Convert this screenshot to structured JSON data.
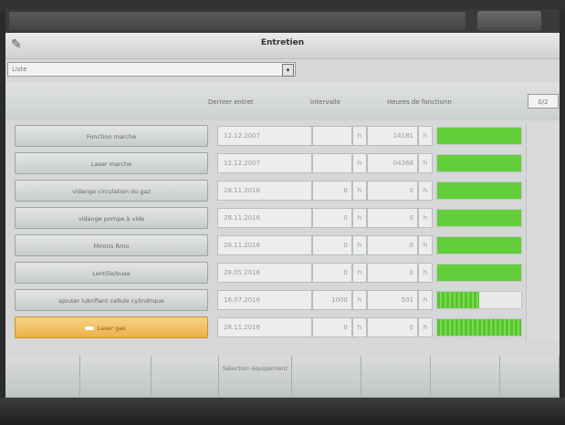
{
  "window": {
    "title": "Entretien"
  },
  "filter": {
    "value": "Liste",
    "arrow": "▾"
  },
  "headers": {
    "last_service": "Dernier entret",
    "interval": "Intervalle",
    "operating_hours": "Heures de fonctionn",
    "right_box": "0/2"
  },
  "rows": [
    {
      "label": "Fonction marche",
      "date": "12.12.2007",
      "interval": "",
      "interval_unit": "h",
      "hours": "14181",
      "hours_unit": "h",
      "level": 1.0,
      "active": false
    },
    {
      "label": "Laser marche",
      "date": "12.12.2007",
      "interval": "",
      "interval_unit": "h",
      "hours": "04368",
      "hours_unit": "h",
      "level": 1.0,
      "active": false
    },
    {
      "label": "vidange circulation du gaz",
      "date": "28.11.2016",
      "interval": "0",
      "interval_unit": "h",
      "hours": "0",
      "hours_unit": "h",
      "level": 1.0,
      "active": false
    },
    {
      "label": "vidange pompe à vide",
      "date": "28.11.2016",
      "interval": "0",
      "interval_unit": "h",
      "hours": "0",
      "hours_unit": "h",
      "level": 1.0,
      "active": false
    },
    {
      "label": "Miroirs Rmo",
      "date": "28.11.2016",
      "interval": "0",
      "interval_unit": "h",
      "hours": "0",
      "hours_unit": "h",
      "level": 1.0,
      "active": false
    },
    {
      "label": "Lentille/buse",
      "date": "28.05.2016",
      "interval": "0",
      "interval_unit": "h",
      "hours": "0",
      "hours_unit": "h",
      "level": 1.0,
      "active": false
    },
    {
      "label": "ajouter lubrifiant cellule cylindrique",
      "date": "16.07.2016",
      "interval": "1000",
      "interval_unit": "h",
      "hours": "501",
      "hours_unit": "h",
      "level": 0.5,
      "active": false
    },
    {
      "label": "Laser gas",
      "date": "28.11.2016",
      "interval": "0",
      "interval_unit": "h",
      "hours": "0",
      "hours_unit": "h",
      "level": 1.0,
      "active": true
    }
  ],
  "toolbar": {
    "selection": "Sélection équipement"
  },
  "colors": {
    "bar_green": "#62cf3a",
    "active_button": "#eab14a"
  }
}
